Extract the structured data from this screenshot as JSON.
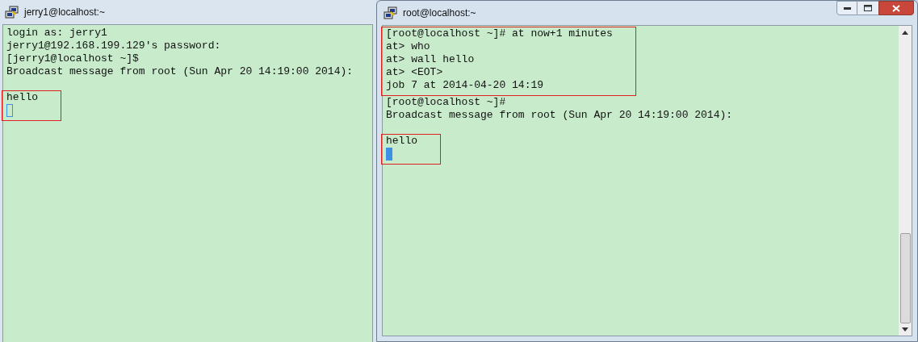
{
  "windows": [
    {
      "title": "jerry1@localhost:~",
      "focused": false,
      "controls": false,
      "blocks": [
        {
          "highlighted": false,
          "after_blank_line": false,
          "cursor": false,
          "lines": [
            "login as: jerry1",
            "jerry1@192.168.199.129's password:",
            "[jerry1@localhost ~]$",
            "Broadcast message from root (Sun Apr 20 14:19:00 2014):"
          ]
        },
        {
          "highlighted": true,
          "after_blank_line": true,
          "cursor": true,
          "lines": [
            "hello"
          ]
        }
      ]
    },
    {
      "title": "root@localhost:~",
      "focused": true,
      "controls": true,
      "blocks": [
        {
          "highlighted": true,
          "after_blank_line": false,
          "cursor": false,
          "lines": [
            "[root@localhost ~]# at now+1 minutes",
            "at> who",
            "at> wall hello",
            "at> <EOT>",
            "job 7 at 2014-04-20 14:19"
          ]
        },
        {
          "highlighted": false,
          "after_blank_line": false,
          "cursor": false,
          "lines": [
            "[root@localhost ~]#",
            "Broadcast message from root (Sun Apr 20 14:19:00 2014):"
          ]
        },
        {
          "highlighted": true,
          "after_blank_line": true,
          "cursor": true,
          "lines": [
            "hello"
          ]
        }
      ]
    }
  ]
}
